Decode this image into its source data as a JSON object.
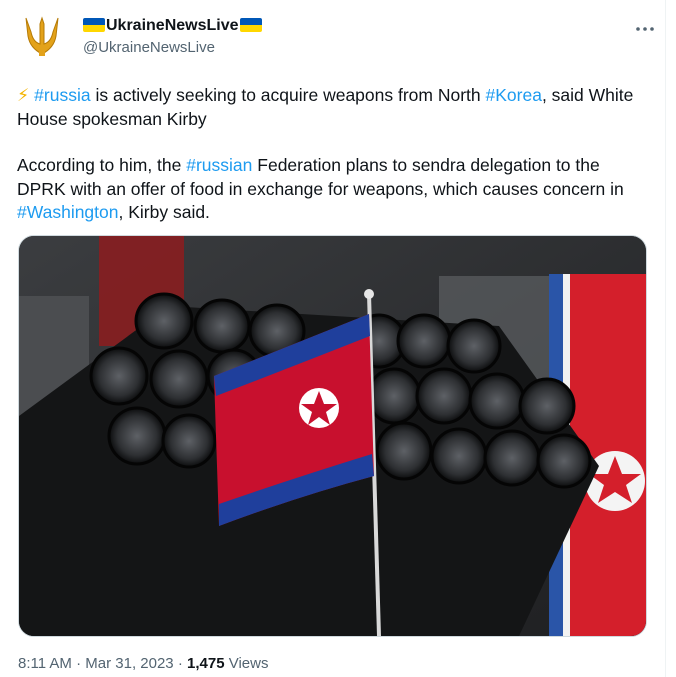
{
  "account": {
    "display_name": "UkraineNewsLive",
    "handle": "@UkraineNewsLive",
    "avatar_icon": "trident-icon",
    "flag_colors": [
      "#0057b7",
      "#ffd700"
    ]
  },
  "menu": {
    "icon": "more-horizontal-icon"
  },
  "tweet": {
    "emoji": "⚡",
    "p1": {
      "t1": " ",
      "h1": "#russia",
      "t2": " is actively seeking to acquire weapons from North ",
      "h2": "#Korea",
      "t3": ", said White House spokesman Kirby"
    },
    "p2": {
      "t1": "According to him, the ",
      "h1": "#russian",
      "t2": " Federation plans to sendra delegation to the DPRK with an offer of food in exchange for weapons, which causes concern in ",
      "h2": "#Washington",
      "t3": ", Kirby said."
    }
  },
  "media": {
    "alt": "North Korean flag in front of rocket launcher tubes"
  },
  "meta": {
    "time": "8:11 AM",
    "sep1": " · ",
    "date": "Mar 31, 2023",
    "sep2": " · ",
    "views_count": "1,475",
    "views_label": " Views"
  },
  "colors": {
    "link": "#1d9bf0",
    "muted": "#536471",
    "text": "#0f1419"
  }
}
